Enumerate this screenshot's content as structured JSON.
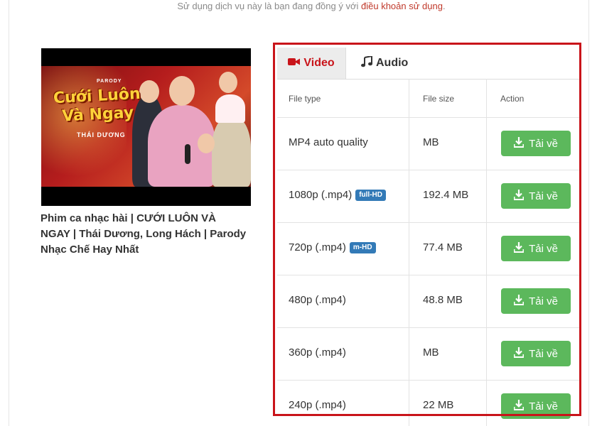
{
  "terms": {
    "text": "Sử dụng dịch vụ này là bạn đang đồng ý với",
    "link": "điều khoản sử dụng",
    "suffix": "."
  },
  "video": {
    "thumbnail_caption_top": "PARODY",
    "thumbnail_title": "Cưới Luôn Và Ngay",
    "thumbnail_artist": "THÁI DƯƠNG",
    "title": "Phim ca nhạc hài | CƯỚI LUÔN VÀ NGAY | Thái Dương, Long Hách | Parody Nhạc Chế Hay Nhất"
  },
  "tabs": [
    {
      "label": "Video",
      "icon": "video-camera-icon",
      "active": true
    },
    {
      "label": "Audio",
      "icon": "music-note-icon",
      "active": false
    }
  ],
  "table": {
    "headers": [
      "File type",
      "File size",
      "Action"
    ],
    "rows": [
      {
        "type": "MP4 auto quality",
        "badge": "",
        "size": "MB"
      },
      {
        "type": "1080p (.mp4)",
        "badge": "full-HD",
        "size": "192.4 MB"
      },
      {
        "type": "720p (.mp4)",
        "badge": "m-HD",
        "size": "77.4 MB"
      },
      {
        "type": "480p (.mp4)",
        "badge": "",
        "size": "48.8 MB"
      },
      {
        "type": "360p (.mp4)",
        "badge": "",
        "size": "MB"
      },
      {
        "type": "240p (.mp4)",
        "badge": "",
        "size": "22 MB"
      }
    ],
    "download_label": "Tải về",
    "download_icon": "download-icon"
  },
  "colors": {
    "accent_red": "#c9141a",
    "download_green": "#5cb85c",
    "badge_blue": "#337ab7",
    "link_red": "#c0392b"
  }
}
